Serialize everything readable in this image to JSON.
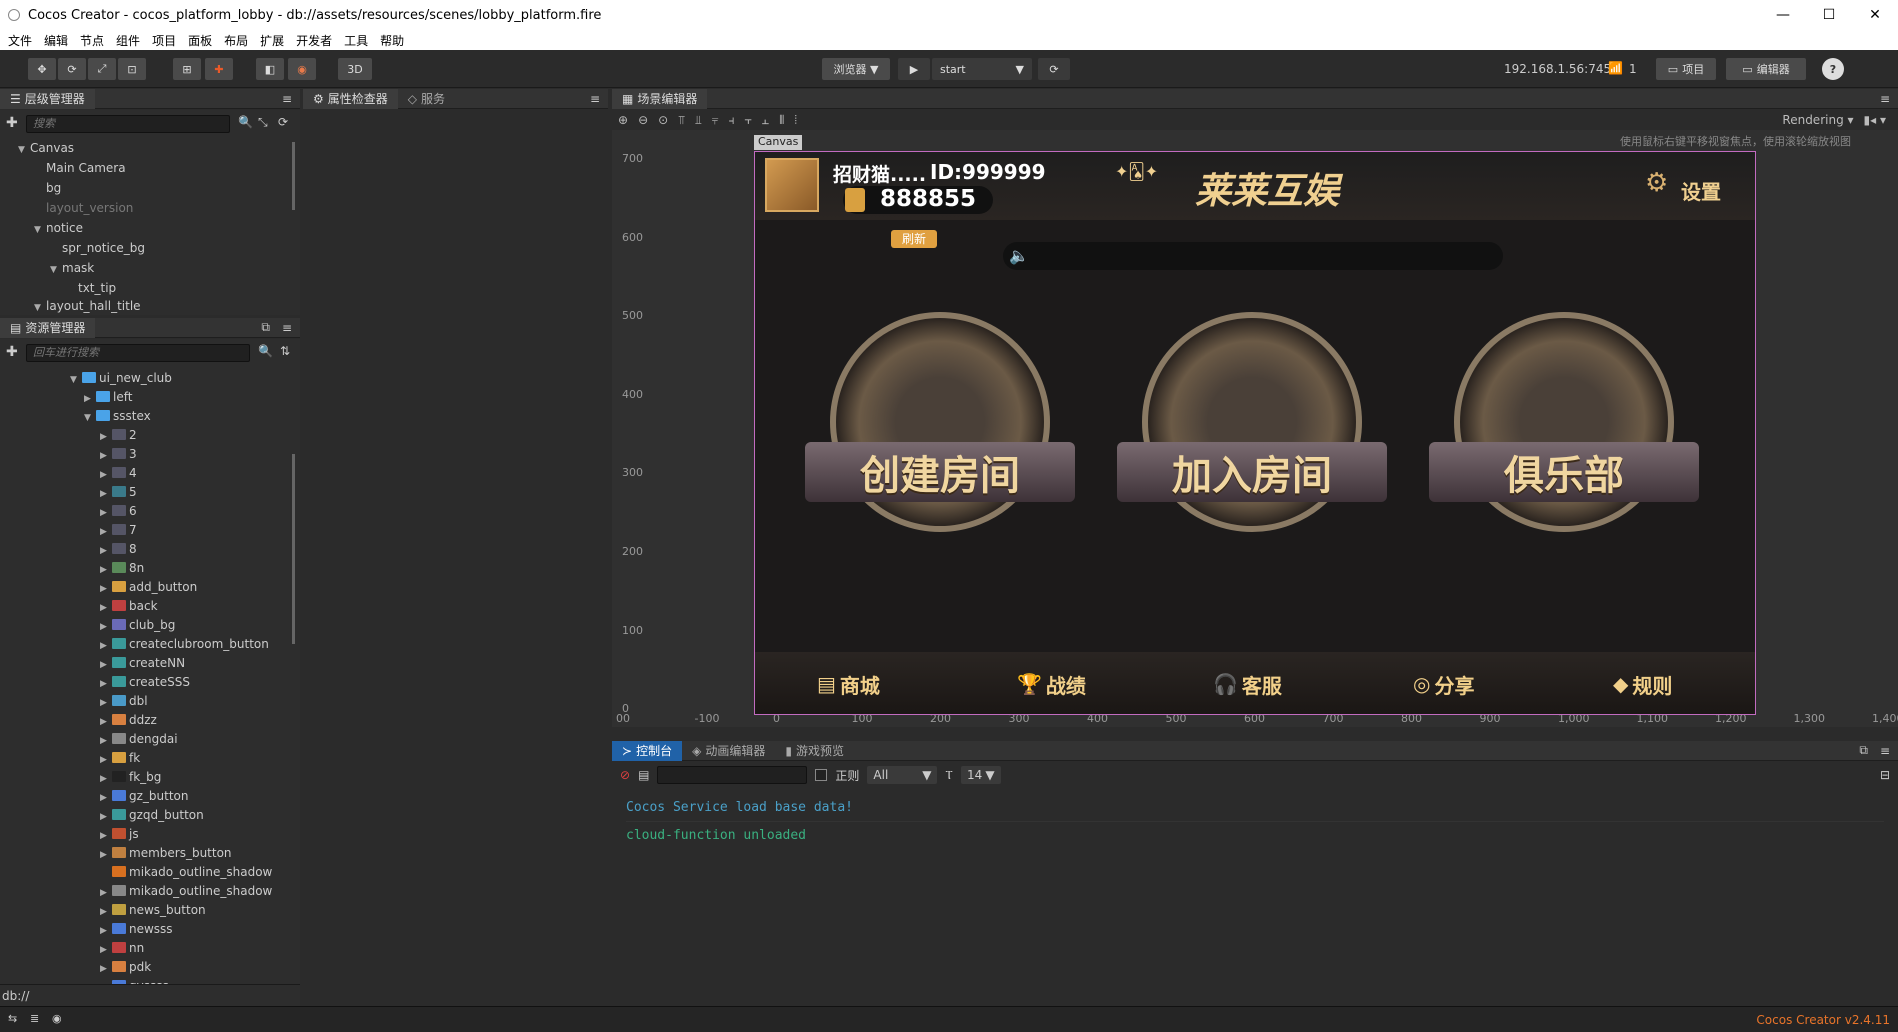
{
  "window": {
    "title": "Cocos Creator - cocos_platform_lobby - db://assets/resources/scenes/lobby_platform.fire"
  },
  "menu": [
    "文件",
    "编辑",
    "节点",
    "组件",
    "项目",
    "面板",
    "布局",
    "扩展",
    "开发者",
    "工具",
    "帮助"
  ],
  "toolbar": {
    "three_d": "3D",
    "browser": "浏览器 ▼",
    "play_target": "start",
    "ip": "192.168.1.56:7456",
    "client_count": "1",
    "project_btn": "项目",
    "editor_btn": "编辑器",
    "help": "?"
  },
  "hierarchy": {
    "tab": "层级管理器",
    "search_placeholder": "搜索",
    "items": [
      {
        "label": "Canvas",
        "arrow": "▼"
      },
      {
        "label": "Main Camera",
        "arrow": ""
      },
      {
        "label": "bg",
        "arrow": ""
      },
      {
        "label": "layout_version",
        "arrow": ""
      },
      {
        "label": "notice",
        "arrow": "▼"
      },
      {
        "label": "spr_notice_bg",
        "arrow": ""
      },
      {
        "label": "mask",
        "arrow": "▼"
      },
      {
        "label": "txt_tip",
        "arrow": ""
      },
      {
        "label": "layout_hall_title",
        "arrow": "▼"
      }
    ]
  },
  "assets": {
    "tab": "资源管理器",
    "search_placeholder": "回车进行搜索",
    "items": [
      {
        "label": "ui_new_club",
        "arrow": "▼",
        "color": "#4aa3e8"
      },
      {
        "label": "left",
        "arrow": "▶",
        "color": "#4aa3e8"
      },
      {
        "label": "ssstex",
        "arrow": "▼",
        "color": "#4aa3e8"
      },
      {
        "label": "2",
        "arrow": "▶",
        "color": "#556"
      },
      {
        "label": "3",
        "arrow": "▶",
        "color": "#556"
      },
      {
        "label": "4",
        "arrow": "▶",
        "color": "#556"
      },
      {
        "label": "5",
        "arrow": "▶",
        "color": "#3a7a8a"
      },
      {
        "label": "6",
        "arrow": "▶",
        "color": "#556"
      },
      {
        "label": "7",
        "arrow": "▶",
        "color": "#556"
      },
      {
        "label": "8",
        "arrow": "▶",
        "color": "#556"
      },
      {
        "label": "8n",
        "arrow": "▶",
        "color": "#5a8a5a"
      },
      {
        "label": "add_button",
        "arrow": "▶",
        "color": "#d8a040"
      },
      {
        "label": "back",
        "arrow": "▶",
        "color": "#c04040"
      },
      {
        "label": "club_bg",
        "arrow": "▶",
        "color": "#6a6ab8"
      },
      {
        "label": "createclubroom_button",
        "arrow": "▶",
        "color": "#3a9a9a"
      },
      {
        "label": "createNN",
        "arrow": "▶",
        "color": "#3a9a9a"
      },
      {
        "label": "createSSS",
        "arrow": "▶",
        "color": "#3a9a9a"
      },
      {
        "label": "dbl",
        "arrow": "▶",
        "color": "#4a9ac8"
      },
      {
        "label": "ddzz",
        "arrow": "▶",
        "color": "#d88040"
      },
      {
        "label": "dengdai",
        "arrow": "▶",
        "color": "#888"
      },
      {
        "label": "fk",
        "arrow": "▶",
        "color": "#d8a040"
      },
      {
        "label": "fk_bg",
        "arrow": "▶",
        "color": "#222"
      },
      {
        "label": "gz_button",
        "arrow": "▶",
        "color": "#4a7ad8"
      },
      {
        "label": "gzqd_button",
        "arrow": "▶",
        "color": "#3a9a9a"
      },
      {
        "label": "js",
        "arrow": "▶",
        "color": "#c05030"
      },
      {
        "label": "members_button",
        "arrow": "▶",
        "color": "#c08040"
      },
      {
        "label": "mikado_outline_shadow",
        "arrow": "",
        "color": "#d87020"
      },
      {
        "label": "mikado_outline_shadow",
        "arrow": "▶",
        "color": "#888"
      },
      {
        "label": "news_button",
        "arrow": "▶",
        "color": "#c0a040"
      },
      {
        "label": "newsss",
        "arrow": "▶",
        "color": "#4a7ad8"
      },
      {
        "label": "nn",
        "arrow": "▶",
        "color": "#c04040"
      },
      {
        "label": "pdk",
        "arrow": "▶",
        "color": "#d88040"
      },
      {
        "label": "qyssss",
        "arrow": "▶",
        "color": "#4a7ad8"
      }
    ],
    "path": "db://"
  },
  "inspector": {
    "tab_props": "属性检查器",
    "tab_service": "服务"
  },
  "scene": {
    "tab": "场景编辑器",
    "rendering": "Rendering",
    "hint": "使用鼠标右键平移视窗焦点，使用滚轮缩放视图",
    "canvas_label": "Canvas",
    "y_ticks": [
      "700",
      "600",
      "500",
      "400",
      "300",
      "200",
      "100",
      "0"
    ],
    "x_ticks": [
      "00",
      "-100",
      "0",
      "100",
      "200",
      "300",
      "400",
      "500",
      "600",
      "700",
      "800",
      "900",
      "1,000",
      "1,100",
      "1,200",
      "1,300",
      "1,400"
    ]
  },
  "game": {
    "player_name": "招财猫.....",
    "player_id": "ID:999999",
    "coins": "888855",
    "refresh": "刷新",
    "brand": "莱莱互娱",
    "settings": "设置",
    "rooms": [
      "创建房间",
      "加入房间",
      "俱乐部"
    ],
    "bottom": [
      "商城",
      "战绩",
      "客服",
      "分享",
      "规则"
    ]
  },
  "console": {
    "tabs": [
      "控制台",
      "动画编辑器",
      "游戏预览"
    ],
    "regex": "正则",
    "level": "All",
    "font_size": "14",
    "logs": [
      "Cocos Service load base data!",
      "cloud-function unloaded"
    ]
  },
  "status": {
    "version": "Cocos Creator v2.4.11"
  }
}
